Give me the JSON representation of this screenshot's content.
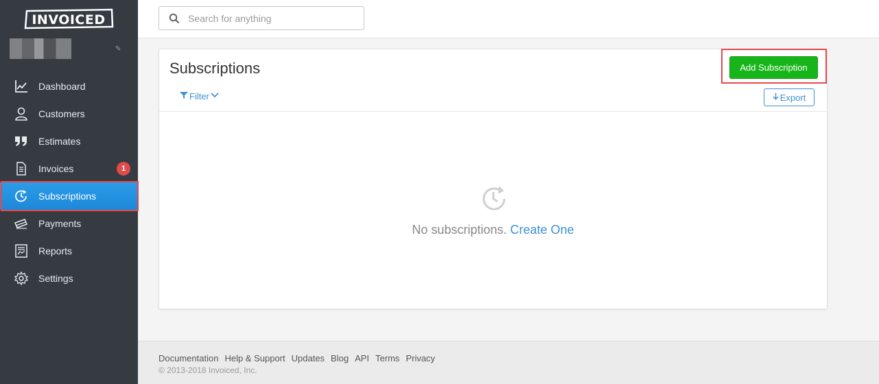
{
  "app": {
    "logo_text": "INVOICED"
  },
  "sidebar": {
    "items": [
      {
        "label": "Dashboard",
        "icon": "dashboard-chart-icon"
      },
      {
        "label": "Customers",
        "icon": "person-icon"
      },
      {
        "label": "Estimates",
        "icon": "quote-icon"
      },
      {
        "label": "Invoices",
        "icon": "document-icon",
        "badge": "1"
      },
      {
        "label": "Subscriptions",
        "icon": "clock-refresh-icon",
        "active": true
      },
      {
        "label": "Payments",
        "icon": "money-icon"
      },
      {
        "label": "Reports",
        "icon": "report-icon"
      },
      {
        "label": "Settings",
        "icon": "gear-icon"
      }
    ]
  },
  "search": {
    "placeholder": "Search for anything"
  },
  "main": {
    "title": "Subscriptions",
    "add_button": "Add Subscription",
    "filter_label": "Filter",
    "export_label": "Export",
    "empty_message": "No subscriptions.",
    "empty_link": "Create One"
  },
  "footer": {
    "links": [
      "Documentation",
      "Help & Support",
      "Updates",
      "Blog",
      "API",
      "Terms",
      "Privacy"
    ],
    "copyright": "© 2013-2018 Invoiced, Inc."
  },
  "colors": {
    "sidebar_bg": "#353b41",
    "active_blue": "#2b9ce9",
    "primary_green": "#17b51a",
    "link_blue": "#3d8fd6",
    "badge_red": "#e04c4c",
    "highlight_red": "#e8474c"
  }
}
